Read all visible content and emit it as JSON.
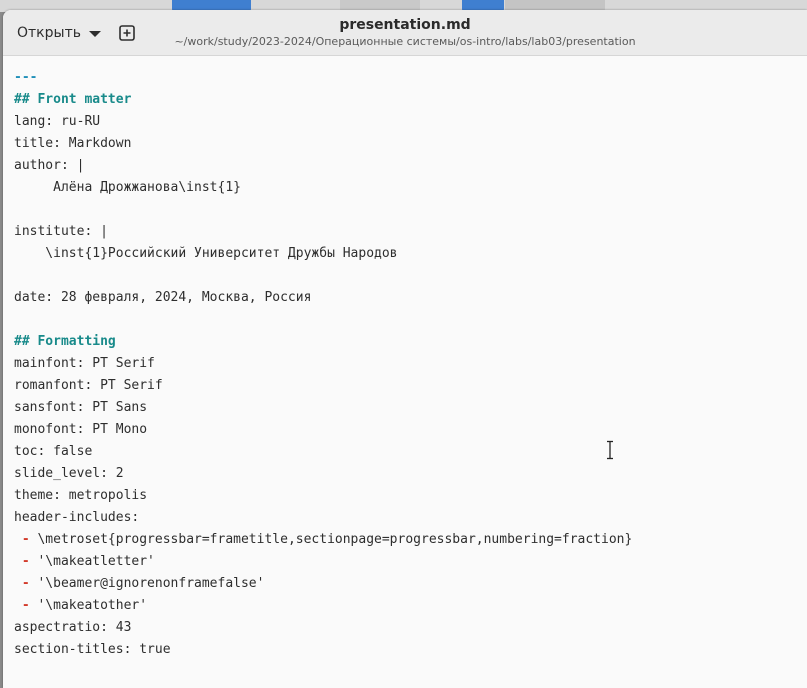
{
  "toolbar": {
    "open_label": "Открыть",
    "new_tab_icon": "new-document-icon"
  },
  "title": {
    "filename": "presentation.md",
    "path": "~/work/study/2023-2024/Операционные системы/os-intro/labs/lab03/presentation"
  },
  "colors": {
    "heading": "#188a8a",
    "rule": "#1f8fb8",
    "list_dash": "#d23a2a",
    "text": "#2e2e2e",
    "editor_bg": "#fafafa",
    "headerbar_bg": "#ebebeb"
  },
  "editor": {
    "lines": [
      {
        "type": "hr",
        "text": "---"
      },
      {
        "type": "heading",
        "text": "## Front matter"
      },
      {
        "type": "text",
        "text": "lang: ru-RU"
      },
      {
        "type": "text",
        "text": "title: Markdown"
      },
      {
        "type": "text",
        "text": "author: |"
      },
      {
        "type": "text",
        "text": "     Алёна Дрожжанова\\inst{1}"
      },
      {
        "type": "text",
        "text": ""
      },
      {
        "type": "text",
        "text": "institute: |"
      },
      {
        "type": "text",
        "text": "    \\inst{1}Российский Университет Дружбы Народов"
      },
      {
        "type": "text",
        "text": ""
      },
      {
        "type": "text",
        "text": "date: 28 февраля, 2024, Москва, Россия"
      },
      {
        "type": "text",
        "text": ""
      },
      {
        "type": "heading",
        "text": "## Formatting"
      },
      {
        "type": "text",
        "text": "mainfont: PT Serif"
      },
      {
        "type": "text",
        "text": "romanfont: PT Serif"
      },
      {
        "type": "text",
        "text": "sansfont: PT Sans"
      },
      {
        "type": "text",
        "text": "monofont: PT Mono"
      },
      {
        "type": "text",
        "text": "toc: false"
      },
      {
        "type": "text",
        "text": "slide_level: 2"
      },
      {
        "type": "text",
        "text": "theme: metropolis"
      },
      {
        "type": "text",
        "text": "header-includes:"
      },
      {
        "type": "list",
        "dash": " - ",
        "text": "\\metroset{progressbar=frametitle,sectionpage=progressbar,numbering=fraction}"
      },
      {
        "type": "list",
        "dash": " - ",
        "text": "'\\makeatletter'"
      },
      {
        "type": "list",
        "dash": " - ",
        "text": "'\\beamer@ignorenonframefalse'"
      },
      {
        "type": "list",
        "dash": " - ",
        "text": "'\\makeatother'"
      },
      {
        "type": "text",
        "text": "aspectratio: 43"
      },
      {
        "type": "text",
        "text": "section-titles: true"
      }
    ]
  }
}
